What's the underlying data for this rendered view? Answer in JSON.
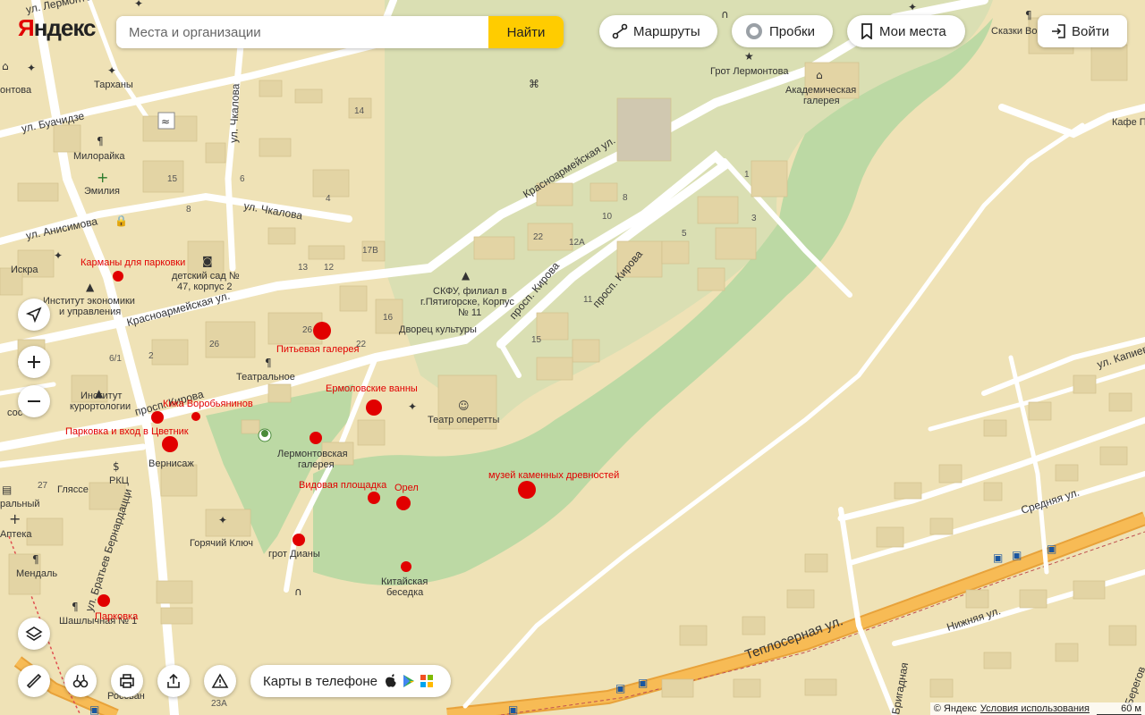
{
  "header": {
    "logo_first": "Я",
    "logo_rest": "ндекс",
    "search_placeholder": "Места и организации",
    "find_label": "Найти",
    "routes_label": "Маршруты",
    "traffic_label": "Пробки",
    "my_places_label": "Мои места",
    "login_label": "Войти"
  },
  "promo": {
    "label": "Карты в телефоне"
  },
  "footer": {
    "copyright": "© Яндекс",
    "terms": "Условия использования",
    "scale": "60 м"
  },
  "colors": {
    "land": "#efe2b6",
    "park": "#bcd9a4",
    "road": "#ffffff",
    "highway": "#f4b043",
    "building": "#e3d4a4",
    "marker": "#e10000",
    "button": "#ffcc00"
  },
  "markers": [
    {
      "label": "Карманы для парковки"
    },
    {
      "label": "Питьевая галерея"
    },
    {
      "label": "Ермоловские ванны"
    },
    {
      "label": "Кика Воробьянинов"
    },
    {
      "label": "Парковка и вход в Цветник"
    },
    {
      "label": "Видовая площадка"
    },
    {
      "label": "Орел"
    },
    {
      "label": "музей каменных древностей"
    },
    {
      "label": "Парковка"
    }
  ],
  "streets": {
    "lermontova": "ул. Лермонтова",
    "buachidze": "ул. Буачидзе",
    "anisimova": "ул. Анисимова",
    "chkalova_v": "ул. Чкалова",
    "chkalova_h": "ул. Чкалова",
    "krasnoarm1": "Красноармейская ул.",
    "krasnoarm2": "Красноармейская ул.",
    "kirova1": "просп. Кирова",
    "kirova2": "просп. Кирова",
    "kirova3": "просп. Кирова",
    "bratev": "ул. Братьев Бернардацци",
    "teploserna": "Теплосерная ул.",
    "srednyaya": "Средняя ул.",
    "nizhnyaya": "Нижняя ул.",
    "kapiev": "ул. Капиева",
    "brigad": "Бригадная",
    "beregovaya": "Берегов"
  },
  "places": {
    "tarhany": "Тарханы",
    "milorayka": "Милорайка",
    "emiliya": "Эмилия",
    "iskra": "Искра",
    "institut_ek1": "Институт экономики",
    "institut_ek2": "и управления",
    "detsad1": "детский сад №",
    "detsad2": "47, корпус 2",
    "skfu1": "СКФУ, филиал в",
    "skfu2": "г.Пятигорске, Корпус",
    "skfu3": "№ 11",
    "dvorec": "Дворец культуры",
    "teatralnoe": "Театральное",
    "inst_kur1": "Институт",
    "inst_kur2": "курортологии",
    "teatr_operetty": "Театр оперетты",
    "lerm_gal1": "Лермонтовская",
    "lerm_gal2": "галерея",
    "vernisazh": "Вернисаж",
    "glyase": "Гляссе",
    "rkc": "РКЦ",
    "apteka": "Аптека",
    "mendal": "Мендаль",
    "goryachiy": "Горячий Ключ",
    "grot_diany": "грот Дианы",
    "kit_bes1": "Китайская",
    "kit_bes2": "беседка",
    "shashlychnaya": "Шашлычная № 1",
    "rossvan": "Россван",
    "grot_lerm": "Грот Лермонтова",
    "akad_gal1": "Академическая",
    "akad_gal2": "галерея",
    "skazki": "Сказки Во",
    "kafe": "Кафе П",
    "ontova": "онтова",
    "sos": "сос",
    "ralny": "ральный"
  },
  "numbers": [
    "14",
    "15",
    "8",
    "6",
    "4",
    "13",
    "12",
    "17В",
    "16",
    "26",
    "22",
    "1",
    "3",
    "5",
    "10",
    "22",
    "12А",
    "8",
    "11",
    "15",
    "6/1",
    "2",
    "26",
    "27",
    "23А",
    "2"
  ]
}
